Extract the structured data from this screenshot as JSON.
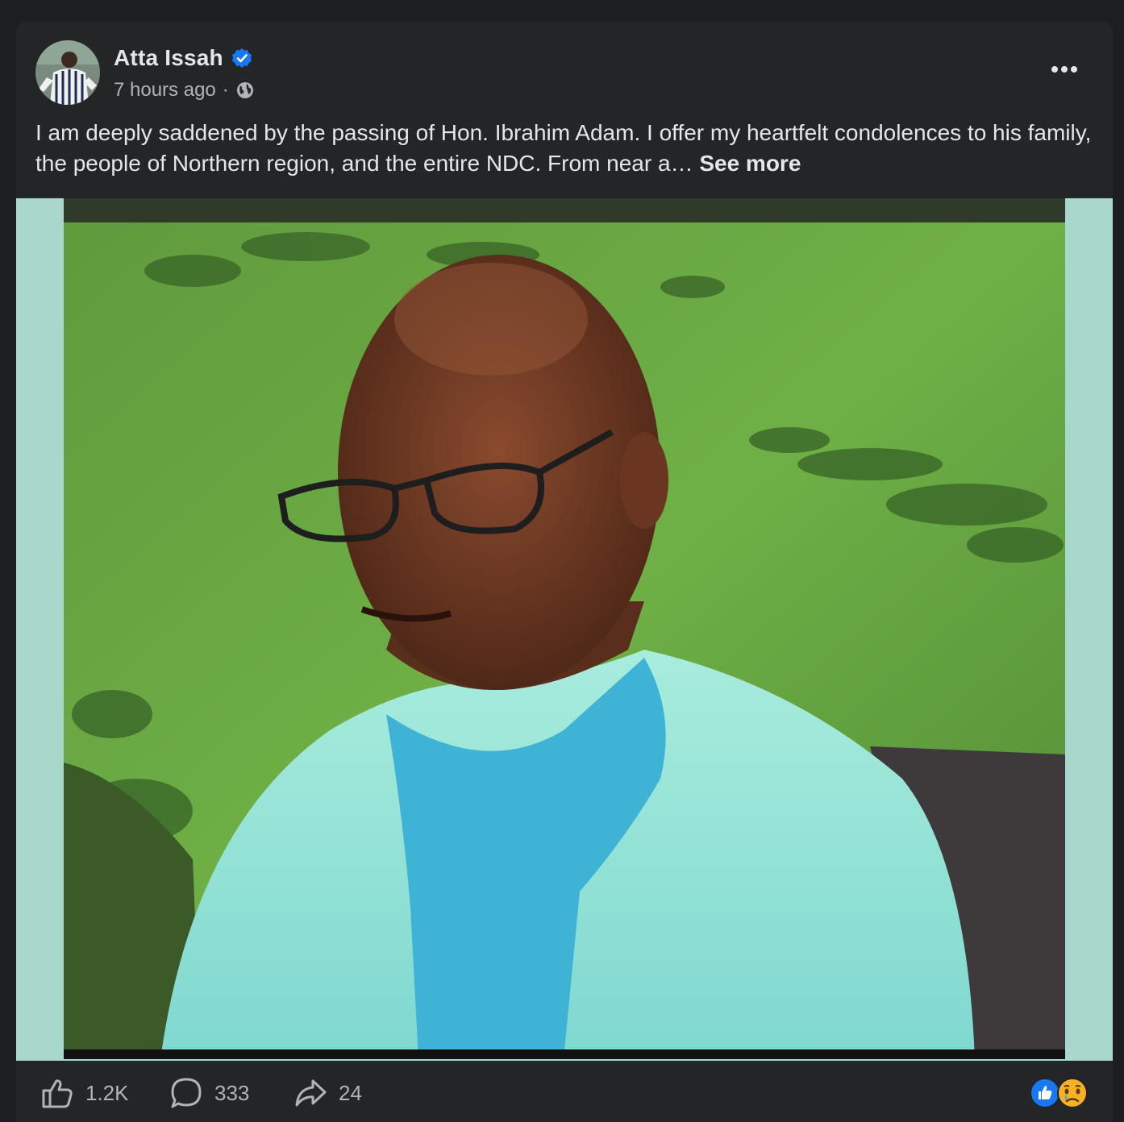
{
  "post": {
    "author": "Atta Issah",
    "timestamp": "7 hours ago",
    "separator": "·",
    "privacy_icon": "globe-icon",
    "verified_icon": "verified-badge-icon",
    "text": "I am deeply saddened by the passing of Hon. Ibrahim Adam. I offer my heartfelt condolences to his family, the people of Northern region, and the entire NDC. From near a…",
    "see_more": "See more",
    "media_border_color": "#a8d8cc"
  },
  "actions": {
    "like_count": "1.2K",
    "comment_count": "333",
    "share_count": "24"
  },
  "reactions": [
    "like",
    "sad"
  ],
  "colors": {
    "background": "#242526",
    "text": "#e4e6eb",
    "secondary": "#b0b3b8",
    "verified": "#1877f2"
  }
}
